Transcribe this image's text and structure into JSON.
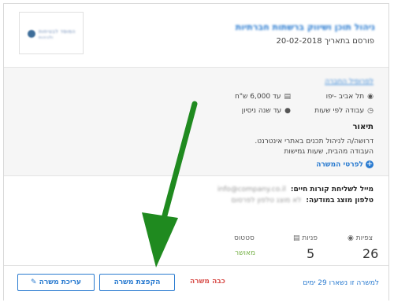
{
  "header": {
    "job_title": "ניהול תוכן ושיווק ברשתות חברתיות",
    "published": "פורסם בתאריך 20-02-2018",
    "logo_text_line1": "המוסד לבטיחות",
    "logo_text_line2": "ולגיהות"
  },
  "body": {
    "company_link": "לפרופיל החברה",
    "location": "תל אביב -יפו",
    "salary": "עד 6,000 ש\"ח",
    "work_type": "עבודה לפי שעות",
    "experience": "עד שנה ניסיון",
    "description_title": "תיאור",
    "description_lines": [
      "דרושה/ה לניהול תכנים באתרי אינטרנט.",
      "העבודה מהבית, שעות גמישות"
    ],
    "details_link": "לפרטי המשרה"
  },
  "contact": {
    "email_label": "מייל לשליחת קורות חיים:",
    "email_value": "info@company.co.il",
    "phone_label": "טלפון מוצג במודעה:",
    "phone_value": "לא מוצג טלפון לפרסום"
  },
  "stats": {
    "views_label": "צפיות",
    "views_value": "26",
    "applications_label": "פניות",
    "applications_value": "5",
    "status_label": "סטטוס",
    "status_value": "מאושר"
  },
  "footer": {
    "remaining": "למשרה זו נשארו 29 ימים",
    "expire_label": "כבה משרה",
    "freeze_label": "הקפצת משרה",
    "edit_label": "עריכת משרה"
  },
  "colors": {
    "link": "#2a7bd0",
    "danger": "#d9534f",
    "success": "#78b24a",
    "arrow": "#1f8a1f"
  }
}
